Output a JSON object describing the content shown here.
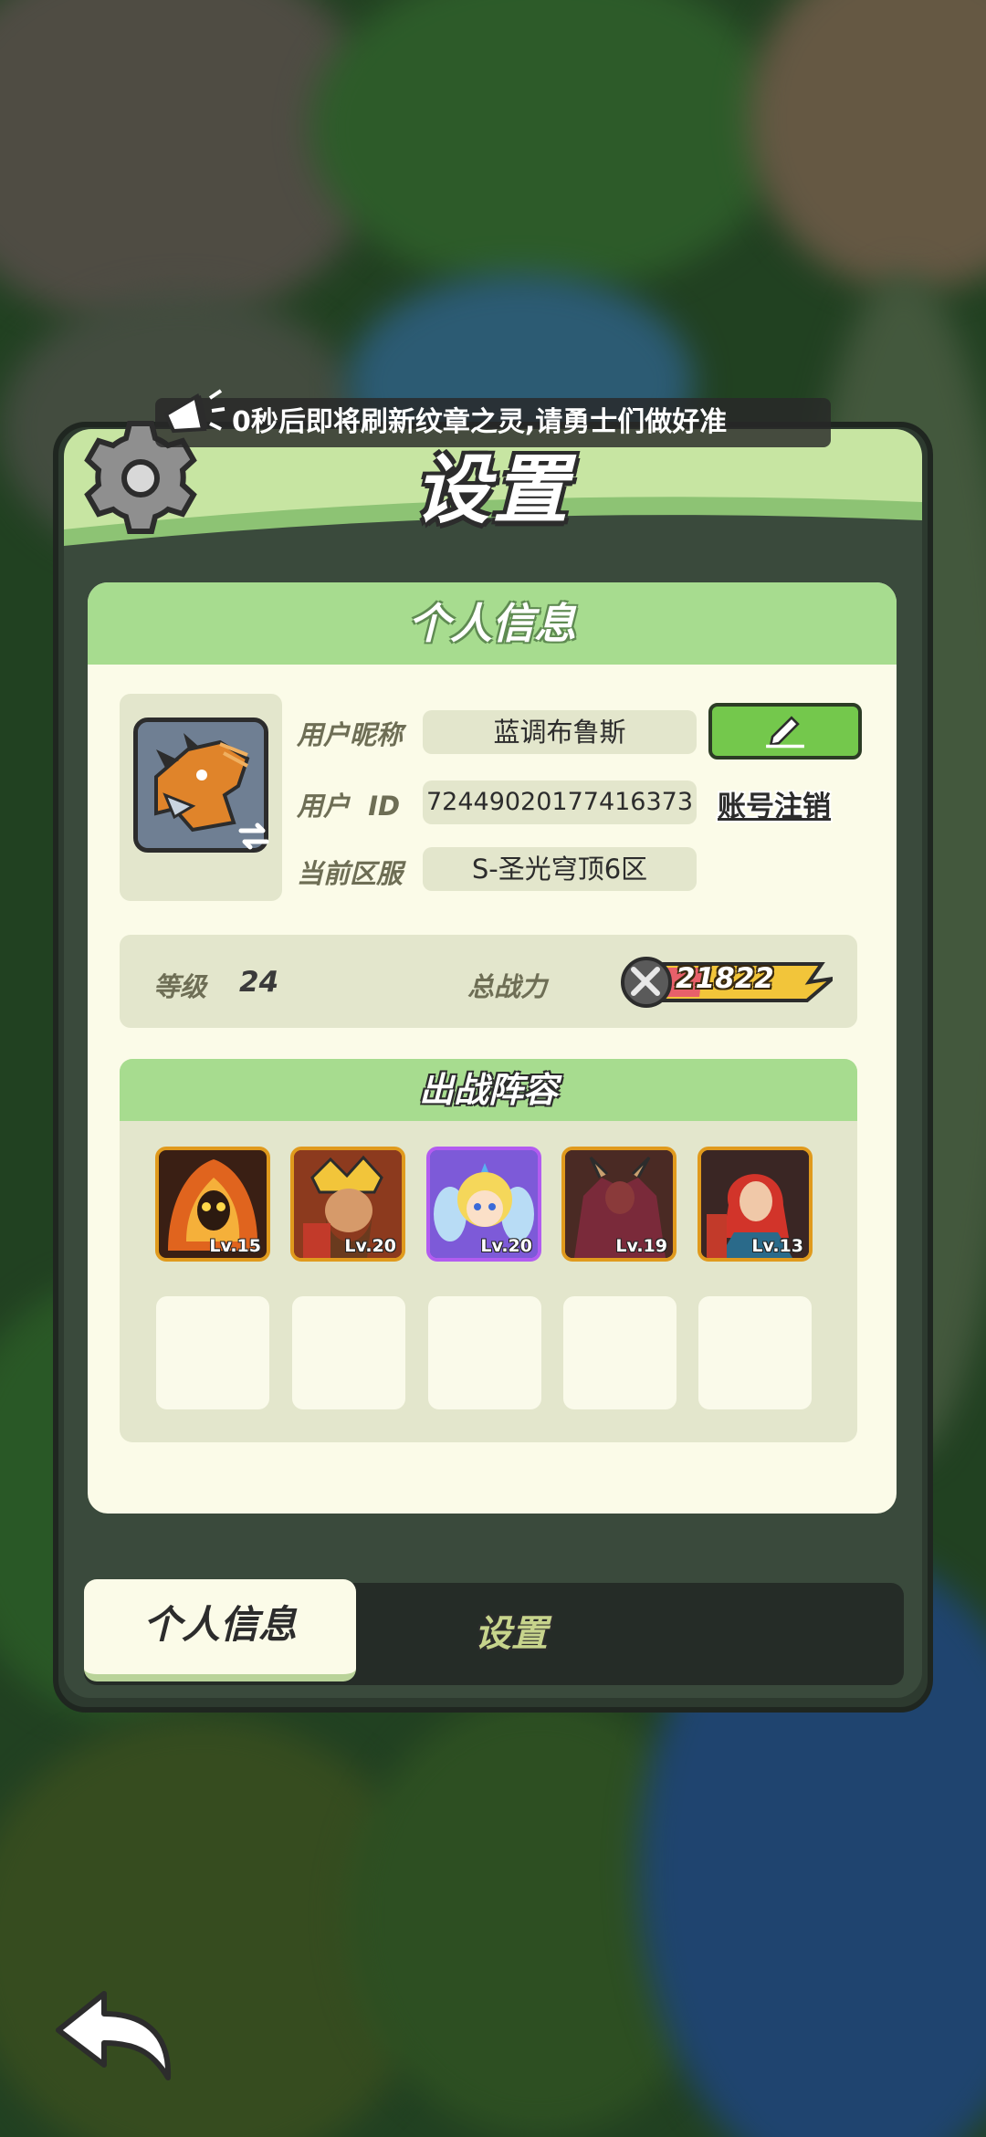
{
  "marquee": {
    "text": "0秒后即将刷新纹章之灵,请勇士们做好准"
  },
  "panel": {
    "title": "设置"
  },
  "card": {
    "header": "个人信息"
  },
  "profile": {
    "nickname_label": "用户昵称",
    "nickname": "蓝调布鲁斯",
    "id_label": "用户  ID",
    "user_id": "72449020177416373",
    "server_label": "当前区服",
    "server": "S-圣光穹顶6区",
    "logout_label": "账号注销"
  },
  "stats": {
    "level_label": "等级",
    "level": "24",
    "power_label": "总战力",
    "power": "21822"
  },
  "lineup": {
    "title": "出战阵容",
    "heroes": [
      {
        "name": "fire-demon",
        "level": "Lv.15"
      },
      {
        "name": "crowned-warrior",
        "level": "Lv.20"
      },
      {
        "name": "fairy",
        "level": "Lv.20"
      },
      {
        "name": "horned-beast",
        "level": "Lv.19"
      },
      {
        "name": "red-haired-mage",
        "level": "Lv.13"
      }
    ]
  },
  "tabs": {
    "active": "个人信息",
    "inactive": "设置"
  },
  "colors": {
    "accent_green": "#a7dc8f",
    "card_bg": "#fbfbe8",
    "power_gold": "#f2c53a"
  }
}
